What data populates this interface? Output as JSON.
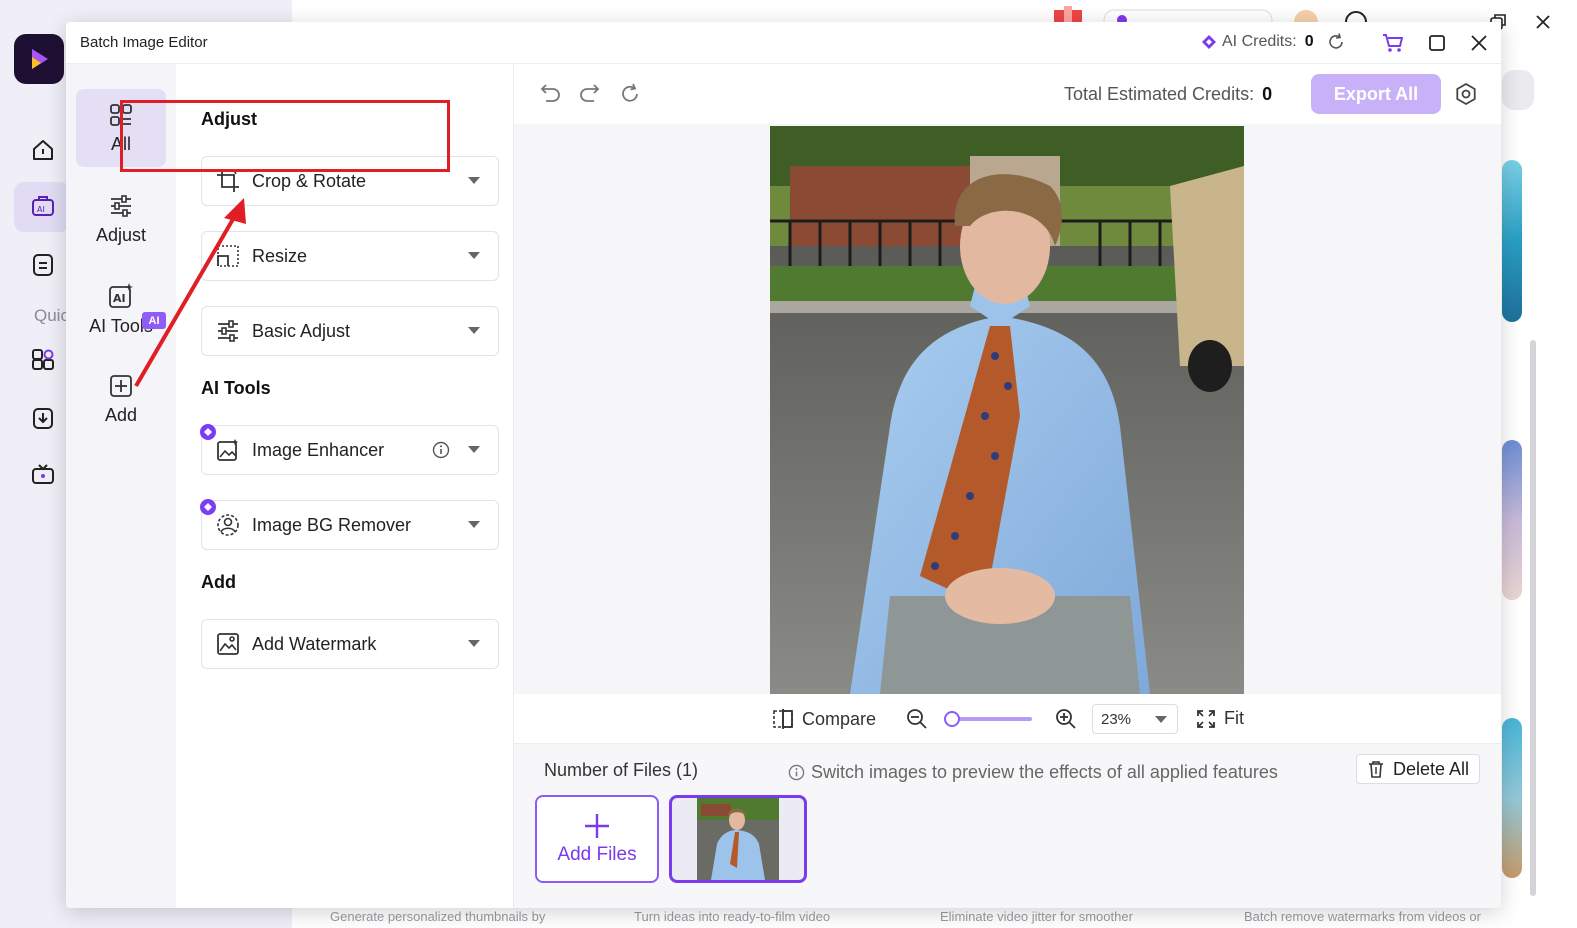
{
  "dialog": {
    "title": "Batch Image Editor",
    "ai_credits_label": "AI Credits:",
    "ai_credits_value": "0"
  },
  "categories": [
    {
      "label": "All",
      "icon": "grid-icon"
    },
    {
      "label": "Adjust",
      "icon": "sliders-icon"
    },
    {
      "label": "AI Tools",
      "icon": "ai-image-icon",
      "badge": "AI"
    },
    {
      "label": "Add",
      "icon": "plus-square-icon"
    }
  ],
  "panel": {
    "section_adjust": "Adjust",
    "section_ai": "AI Tools",
    "section_add": "Add",
    "tools": [
      {
        "label": "Crop & Rotate",
        "icon": "crop-icon"
      },
      {
        "label": "Resize",
        "icon": "resize-icon"
      },
      {
        "label": "Basic Adjust",
        "icon": "sliders-icon"
      },
      {
        "label": "Image Enhancer",
        "icon": "enhance-icon"
      },
      {
        "label": "Image BG Remover",
        "icon": "bg-remove-icon"
      },
      {
        "label": "Add Watermark",
        "icon": "watermark-icon"
      }
    ]
  },
  "toolbar": {
    "estimated_label": "Total Estimated Credits:",
    "estimated_value": "0",
    "export_label": "Export All"
  },
  "zoombar": {
    "compare_label": "Compare",
    "zoom_value": "23%",
    "zoom_level": 0.23,
    "fit_label": "Fit"
  },
  "files": {
    "count_label": "Number of Files (1)",
    "hint": "Switch images to preview the effects of all applied features",
    "delete_label": "Delete All",
    "add_label": "Add Files"
  },
  "background": {
    "quick_label": "Quic",
    "bottom_texts": [
      "Generate personalized thumbnails by",
      "Turn ideas into ready-to-film video",
      "Eliminate video jitter for smoother",
      "Batch remove watermarks from videos or"
    ]
  },
  "colors": {
    "accent": "#7c3aed",
    "export_disabled": "#c9b1fa",
    "highlight": "#e01e26"
  }
}
